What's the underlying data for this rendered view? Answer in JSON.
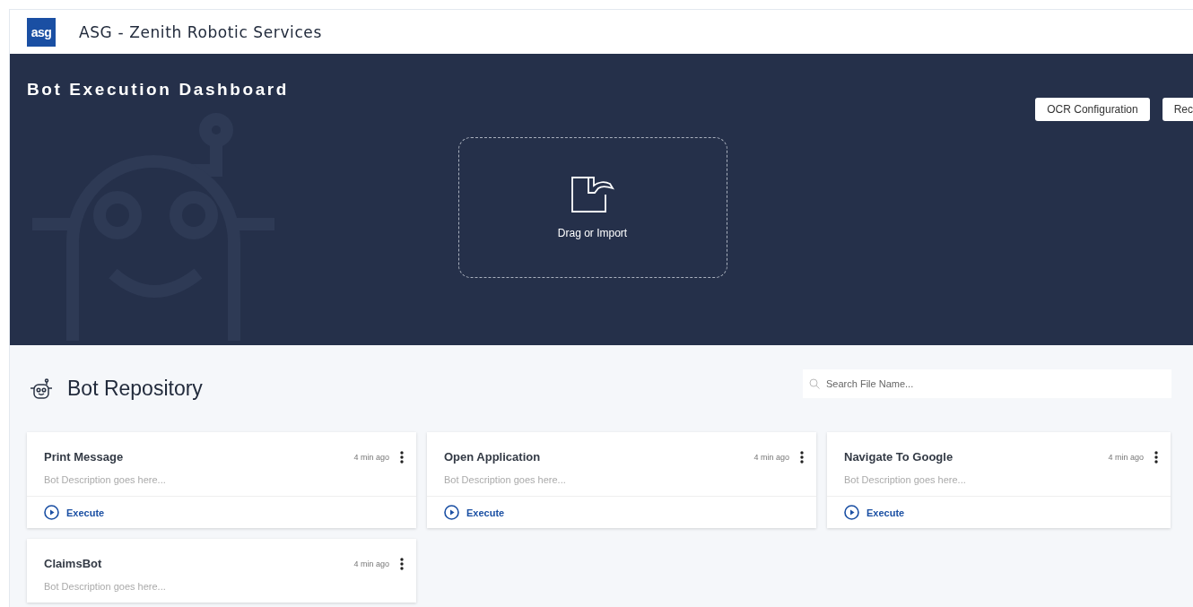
{
  "header": {
    "logo": "asg",
    "title": "ASG - Zenith Robotic Services"
  },
  "banner": {
    "title": "Bot Execution Dashboard",
    "buttons": [
      "OCR Configuration",
      "Rec"
    ],
    "dropzone": {
      "label": "Drag or Import"
    }
  },
  "repository": {
    "title": "Bot Repository",
    "search": {
      "placeholder": "Search File Name..."
    },
    "bots": [
      {
        "name": "Print Message",
        "time": "4 min ago",
        "description": "Bot Description goes here...",
        "action": "Execute"
      },
      {
        "name": "Open Application",
        "time": "4 min ago",
        "description": "Bot Description goes here...",
        "action": "Execute"
      },
      {
        "name": "Navigate To Google",
        "time": "4 min ago",
        "description": "Bot Description goes here...",
        "action": "Execute"
      },
      {
        "name": "ClaimsBot",
        "time": "4 min ago",
        "description": "Bot Description goes here..."
      }
    ]
  }
}
